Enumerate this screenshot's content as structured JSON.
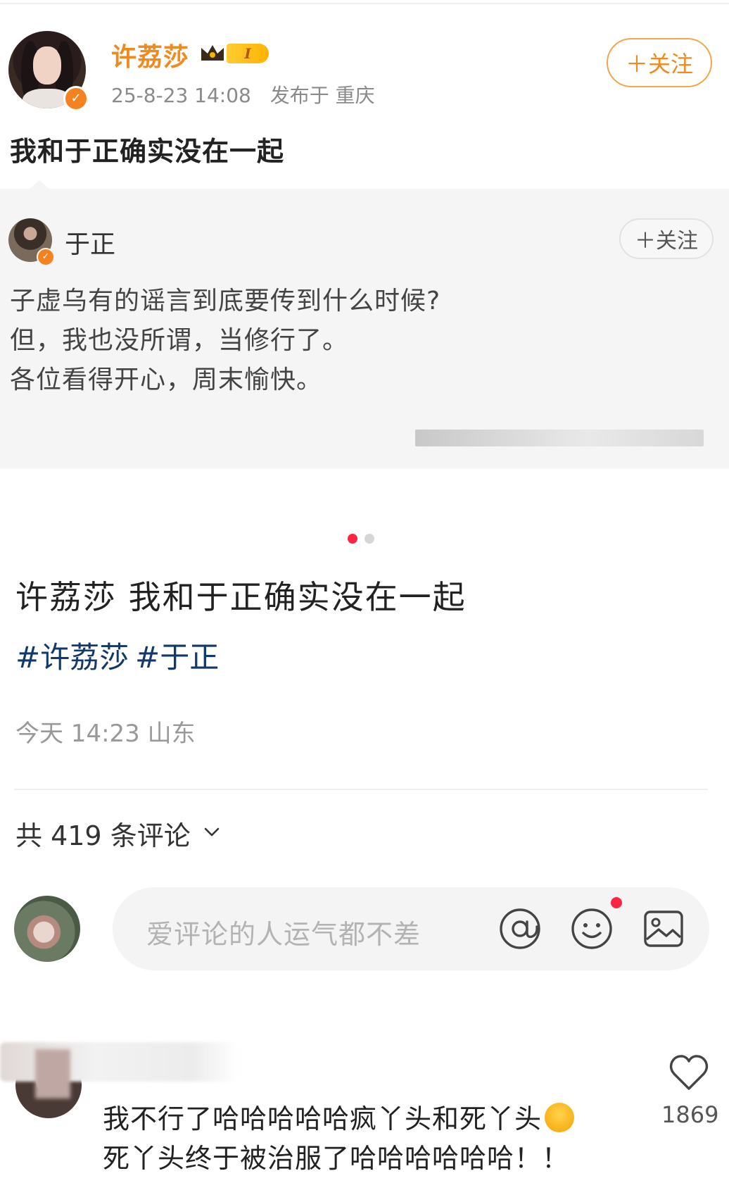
{
  "embedded_post": {
    "author": "许荔莎",
    "level_badge": "I",
    "timestamp": "25-8-23 14:08",
    "location": "发布于 重庆",
    "follow_label": "＋关注",
    "text": "我和于正确实没在一起",
    "repost": {
      "author": "于正",
      "follow_label": "＋关注",
      "lines": [
        "子虚乌有的谣言到底要传到什么时候?",
        "但，我也没所谓，当修行了。",
        "各位看得开心，周末愉快。"
      ]
    }
  },
  "note": {
    "title": "许荔莎 我和于正确实没在一起",
    "tags": [
      "#许荔莎",
      "#于正"
    ],
    "date_location": "今天 14:23 山东"
  },
  "comments": {
    "count_label": "共 419 条评论",
    "input_placeholder": "爱评论的人运气都不差",
    "items": [
      {
        "lines": [
          "我不行了哈哈哈哈哈疯丫头和死丫头",
          "死丫头终于被治服了哈哈哈哈哈哈！！"
        ],
        "likes": "1869"
      }
    ]
  },
  "carousel": {
    "total": 2,
    "active": 1
  },
  "colors": {
    "accent": "#ff2442",
    "orange": "#f08a1c",
    "tag_blue": "#13386c"
  },
  "icons": [
    "chevron-down-icon",
    "at-icon",
    "emoji-icon",
    "image-icon",
    "heart-icon",
    "verified-icon",
    "crown-icon"
  ]
}
